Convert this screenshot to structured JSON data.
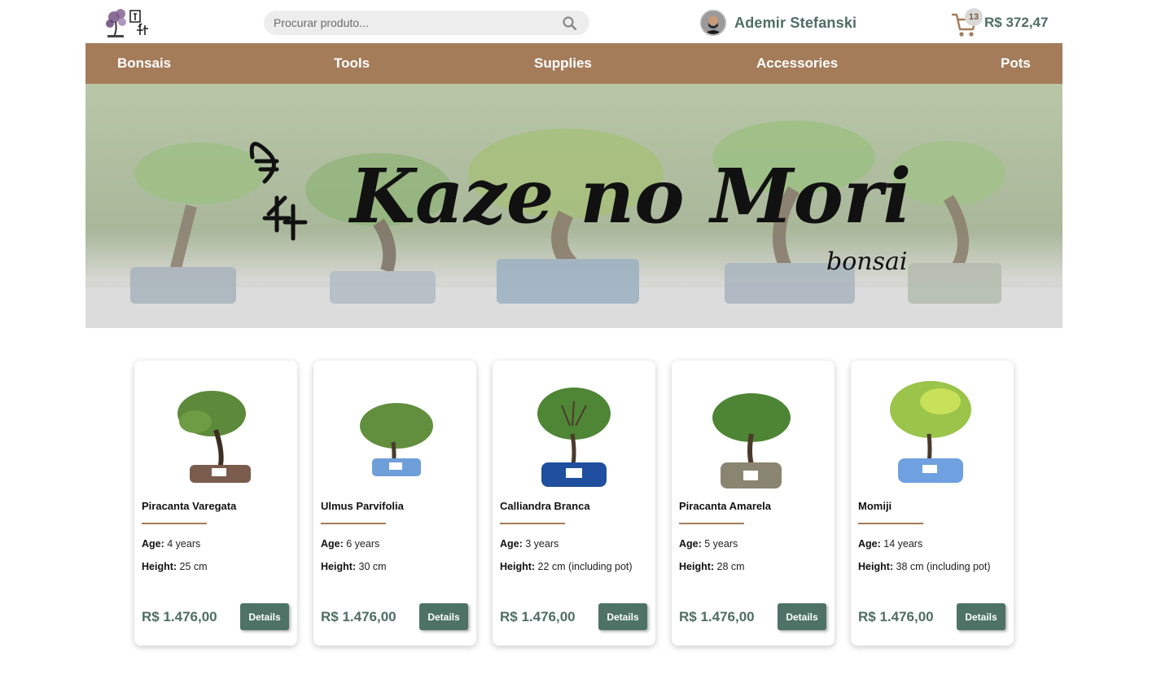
{
  "header": {
    "search": {
      "placeholder": "Procurar produto..."
    },
    "user": {
      "name": "Ademir Stefanski"
    },
    "cart": {
      "count": "13",
      "total": "R$ 372,47"
    }
  },
  "nav": {
    "items": [
      {
        "label": "Bonsais"
      },
      {
        "label": "Tools"
      },
      {
        "label": "Supplies"
      },
      {
        "label": "Accessories"
      },
      {
        "label": "Pots"
      }
    ]
  },
  "banner": {
    "title": "Kaze no Mori",
    "subtitle": "bonsai"
  },
  "products": [
    {
      "name": "Piracanta Varegata",
      "age_label": "Age:",
      "age": " 4 years",
      "height_label": "Height:",
      "height": " 25 cm",
      "price": "R$ 1.476,00",
      "button": "Details",
      "pot_color": "#7a5c4c"
    },
    {
      "name": "Ulmus Parvifolia",
      "age_label": "Age:",
      "age": " 6 years",
      "height_label": "Height:",
      "height": " 30 cm",
      "price": "R$ 1.476,00",
      "button": "Details",
      "pot_color": "#6f9fd8"
    },
    {
      "name": "Calliandra Branca",
      "age_label": "Age:",
      "age": " 3 years",
      "height_label": "Height:",
      "height": " 22 cm (including pot)",
      "price": "R$ 1.476,00",
      "button": "Details",
      "pot_color": "#1f4f9e"
    },
    {
      "name": "Piracanta Amarela",
      "age_label": "Age:",
      "age": " 5 years",
      "height_label": "Height:",
      "height": " 28 cm",
      "price": "R$ 1.476,00",
      "button": "Details",
      "pot_color": "#8a8570"
    },
    {
      "name": "Momiji",
      "age_label": "Age:",
      "age": " 14 years",
      "height_label": "Height:",
      "height": " 38 cm (including pot)",
      "price": "R$ 1.476,00",
      "button": "Details",
      "pot_color": "#6fa0e0"
    }
  ]
}
